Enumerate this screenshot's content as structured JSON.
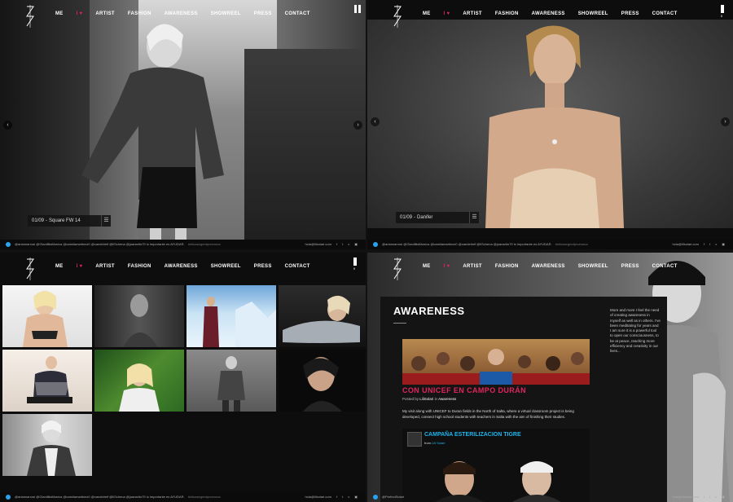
{
  "nav": {
    "items": [
      "ME",
      "ARTIST",
      "FASHION",
      "AWARENESS",
      "SHOWREEL",
      "PRESS",
      "CONTACT"
    ],
    "heart": "I ♥",
    "pause_label": "II"
  },
  "panel1": {
    "caption_index": "01/09",
    "caption_title": "Square FW 14",
    "footer_text": "@ariannarrosi @GianlilliaMonica @camilamartinez0 @candelreif @liSchena @juanarito79 lo importante es AYUDAR.",
    "footer_tag": "#nitoasegredpnomuna",
    "footer_email": "hola@lilsolari.com"
  },
  "panel2": {
    "caption_index": "01/09",
    "caption_title": "Danifer",
    "footer_text": "@ariannarrosi @GianlilliaMonica @camilamartinez0 @candelreif @liSchena @juanarito79 lo importante es AYUDAR.",
    "footer_tag": "#nitoasegredpnomuna",
    "footer_email": "hola@lilsolari.com"
  },
  "panel3": {
    "footer_text": "@ariannarrosi @GianlilliaMonica @camilamartinez0 @candelreif @liSchena @juanarito79 lo importante es AYUDAR.",
    "footer_tag": "#nitoasegredpnomuna",
    "footer_email": "hola@lilsolari.com"
  },
  "panel4": {
    "section_title": "AWARENESS",
    "sidebar": "More and more I feel the need of creating awareness in myself as well as in others. I've been meditating for years and I am sure it is a powerful tool to open our consciousness, to be at peace, reaching more efficiency and creativity in our lives...",
    "post_title": "CON UNICEF EN CAMPO DURÁN",
    "posted_prefix": "Posted by",
    "posted_author": "LiliSolari",
    "posted_in": "in",
    "posted_category": "Awareness",
    "post_body": "My visit along with UNICEF to Duran fields in the North of Salta, where a virtual classroom project is being developed, connect high school students with teachers in Salta with the aim of finishing their studies.",
    "video_title": "CAMPAÑA ESTERILIZACION TIGRE",
    "video_from_prefix": "from",
    "video_from": "Lili Solari",
    "footer_handle": "@PerfectSolari",
    "footer_email": "hola@lilsolari.com"
  },
  "colors": {
    "accent": "#e0245e",
    "video_title": "#1bb7ef",
    "twitter": "#29a3ef"
  }
}
